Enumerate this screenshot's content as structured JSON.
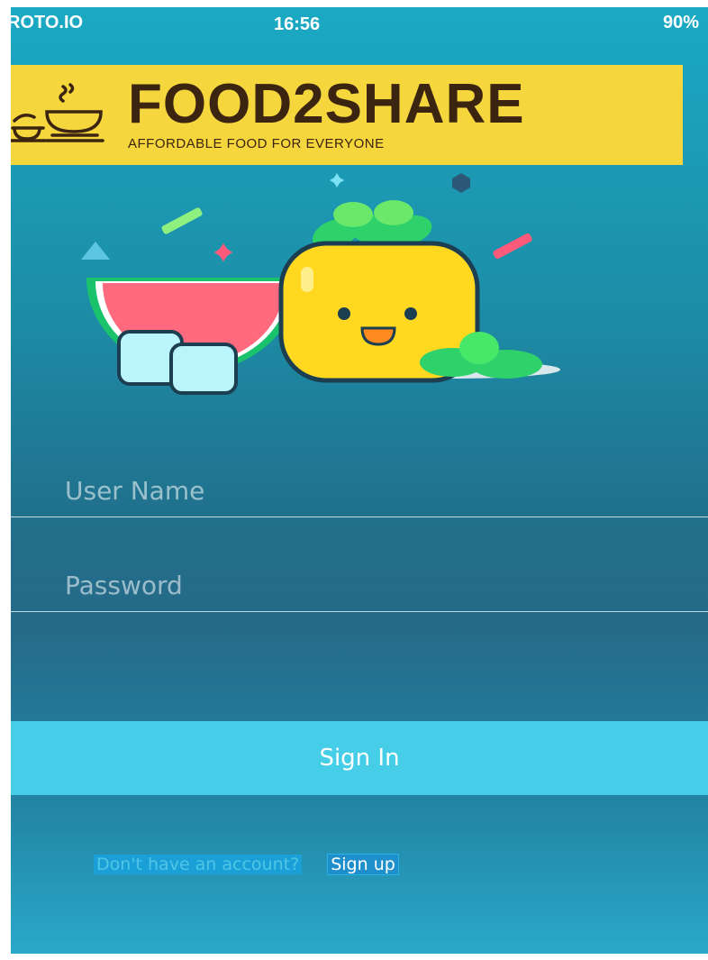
{
  "status_bar": {
    "carrier": "ROTO.IO",
    "time": "16:56",
    "battery": "90%"
  },
  "banner": {
    "title": "FOOD2SHARE",
    "tagline": "AFFORDABLE FOOD FOR EVERYONE"
  },
  "form": {
    "username_placeholder": "User Name",
    "password_placeholder": "Password",
    "signin_label": "Sign In"
  },
  "signup": {
    "prompt": "Don't have an account?",
    "link_label": "Sign up"
  },
  "colors": {
    "banner": "#f6d63d",
    "button": "#46cde8",
    "accent_dark": "#3b2410"
  }
}
